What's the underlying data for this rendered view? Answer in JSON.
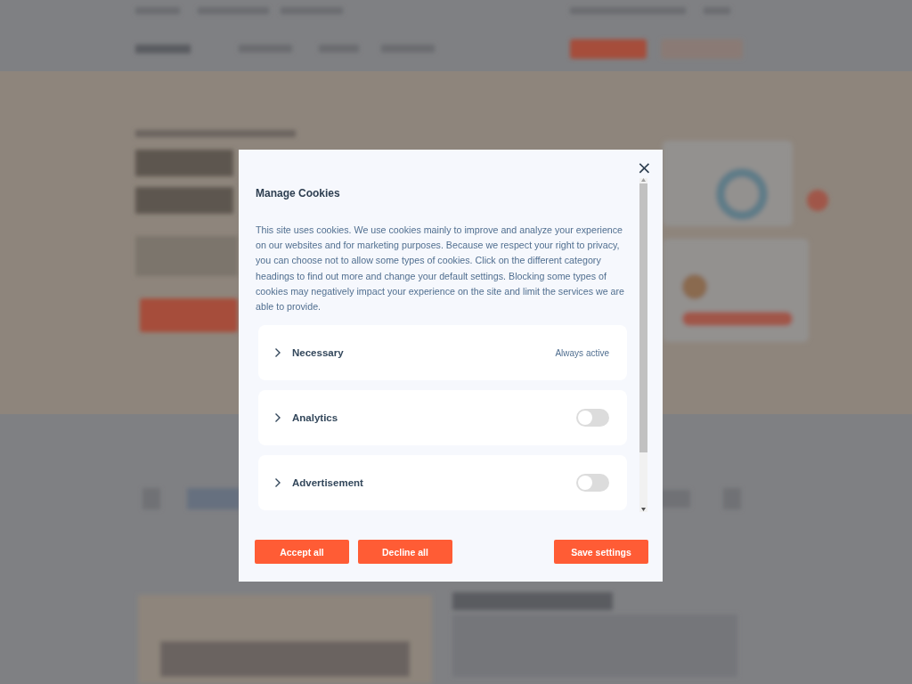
{
  "dialog": {
    "title": "Manage Cookies",
    "close_icon": "×",
    "description": "This site uses cookies. We use cookies mainly to improve and analyze your experience on our websites and for marketing purposes. Because we respect your right to privacy, you can choose not to allow some types of cookies. Click on the different category headings to find out more and change your default settings. Blocking some types of cookies may negatively impact your experience on the site and limit the services we are able to provide.",
    "categories": [
      {
        "kind": "always",
        "label": "Necessary",
        "expanded": false,
        "status": "Always active"
      },
      {
        "kind": "toggle",
        "label": "Analytics",
        "expanded": false,
        "on": false
      },
      {
        "kind": "toggle",
        "label": "Advertisement",
        "expanded": false,
        "on": false
      }
    ],
    "buttons": [
      "Accept all",
      "Decline all",
      "Save settings"
    ]
  }
}
